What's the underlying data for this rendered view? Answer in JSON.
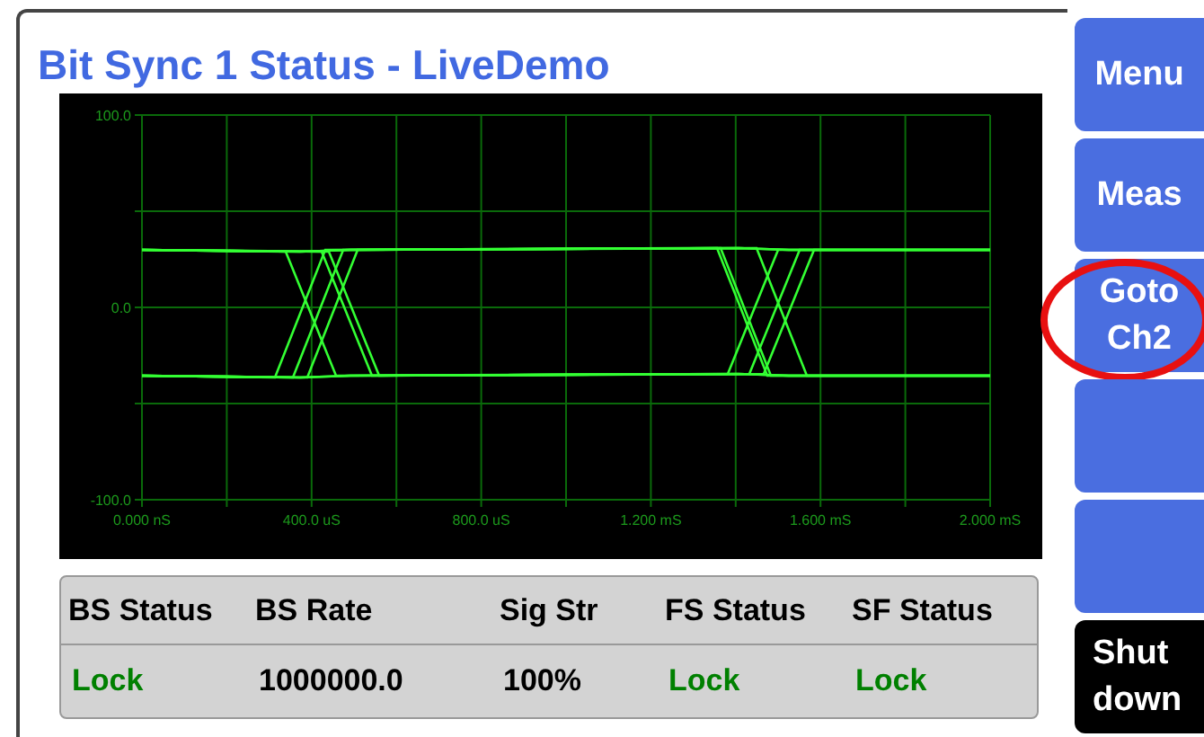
{
  "title": "Bit Sync 1 Status - LiveDemo",
  "scope": {
    "y_labels": [
      "100.0",
      "0.0",
      "-100.0"
    ],
    "x_labels": [
      "0.000 nS",
      "400.0 uS",
      "800.0 uS",
      "1.200 mS",
      "1.600 mS",
      "2.000 mS"
    ]
  },
  "status_table": {
    "columns": [
      "BS Status",
      "BS Rate",
      "Sig Str",
      "FS Status",
      "SF Status"
    ],
    "row": [
      {
        "text": "Lock",
        "color": "#008000"
      },
      {
        "text": "1000000.0",
        "color": "#000000"
      },
      {
        "text": "100%",
        "color": "#000000"
      },
      {
        "text": "Lock",
        "color": "#008000"
      },
      {
        "text": "Lock",
        "color": "#008000"
      }
    ]
  },
  "side_buttons": [
    {
      "kind": "normal",
      "label": "Menu",
      "circled": false
    },
    {
      "kind": "normal",
      "label": "Meas",
      "circled": false
    },
    {
      "kind": "normal",
      "label": "Goto Ch2",
      "circled": true
    },
    {
      "kind": "blank",
      "circled": false
    },
    {
      "kind": "blank",
      "circled": false
    },
    {
      "kind": "dark",
      "label": "Shut down",
      "circled": false
    }
  ]
}
